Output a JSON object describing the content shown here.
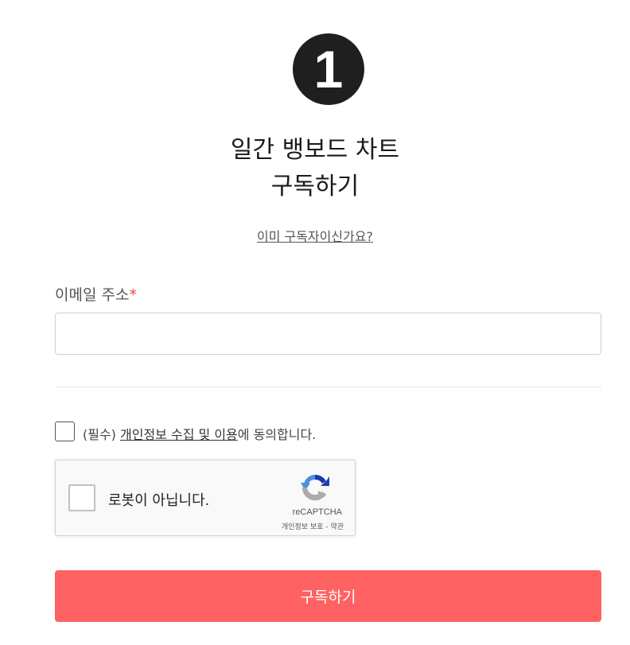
{
  "step": {
    "number": "1"
  },
  "title": {
    "line1": "일간 뱅보드 차트",
    "line2": "구독하기"
  },
  "already_subscriber_link": "이미 구독자이신가요?",
  "email": {
    "label": "이메일 주소",
    "required_mark": "*",
    "value": "",
    "placeholder": ""
  },
  "consent": {
    "prefix": "(필수) ",
    "link": "개인정보 수집 및 이용",
    "suffix": "에 동의합니다.",
    "checked": false
  },
  "recaptcha": {
    "label": "로봇이 아닙니다.",
    "brand": "reCAPTCHA",
    "privacy": "개인정보 보호",
    "separator": " - ",
    "terms": "약관",
    "checked": false
  },
  "submit_label": "구독하기",
  "colors": {
    "accent": "#ff6262",
    "required": "#e5484d",
    "badge": "#1f1f1f"
  }
}
